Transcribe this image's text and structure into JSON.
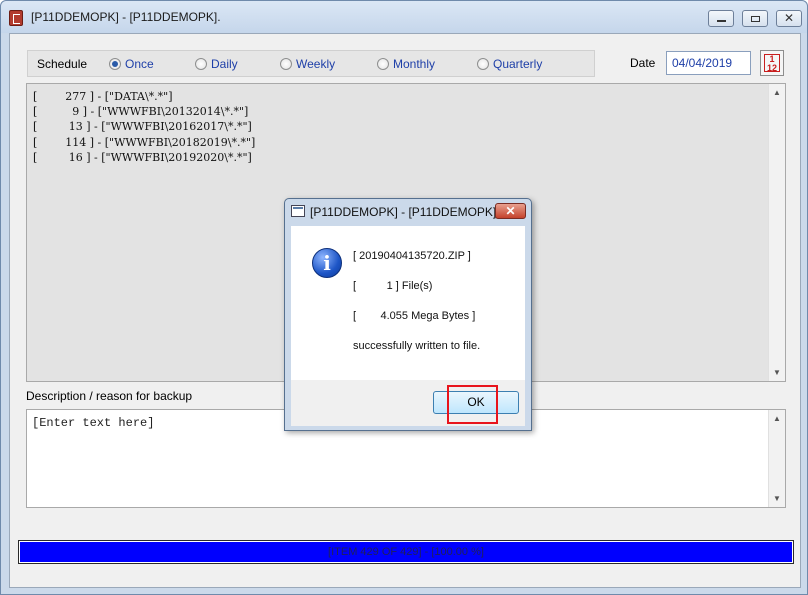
{
  "window": {
    "title": "[P11DDEMOPK] - [P11DDEMOPK]."
  },
  "schedule": {
    "label": "Schedule",
    "options": [
      {
        "label": "Once",
        "selected": true
      },
      {
        "label": "Daily",
        "selected": false
      },
      {
        "label": "Weekly",
        "selected": false
      },
      {
        "label": "Monthly",
        "selected": false
      },
      {
        "label": "Quarterly",
        "selected": false
      }
    ]
  },
  "date": {
    "label": "Date",
    "value": "04/04/2019"
  },
  "log": {
    "lines": [
      "[        277 ] - [\"DATA\\*.*\"]",
      "[          9 ] - [\"WWWFBI\\20132014\\*.*\"]",
      "[         13 ] - [\"WWWFBI\\20162017\\*.*\"]",
      "[        114 ] - [\"WWWFBI\\20182019\\*.*\"]",
      "[         16 ] - [\"WWWFBI\\20192020\\*.*\"]"
    ]
  },
  "description": {
    "label": "Description / reason for backup",
    "placeholder": "[Enter text here]"
  },
  "progress": {
    "text": "[ITEM 429 OF 429] - [100.00 %]",
    "fraction": 1.0,
    "fill_color": "#0000fe"
  },
  "dialog": {
    "title": "[P11DDEMOPK] - [P11DDEMOPK].",
    "icon": "info-icon",
    "lines": [
      "[ 20190404135720.ZIP ]",
      "[          1 ] File(s)",
      "[        4.055 Mega Bytes ]",
      "successfully written to file."
    ],
    "ok_label": "OK",
    "close_glyph": "✕"
  }
}
